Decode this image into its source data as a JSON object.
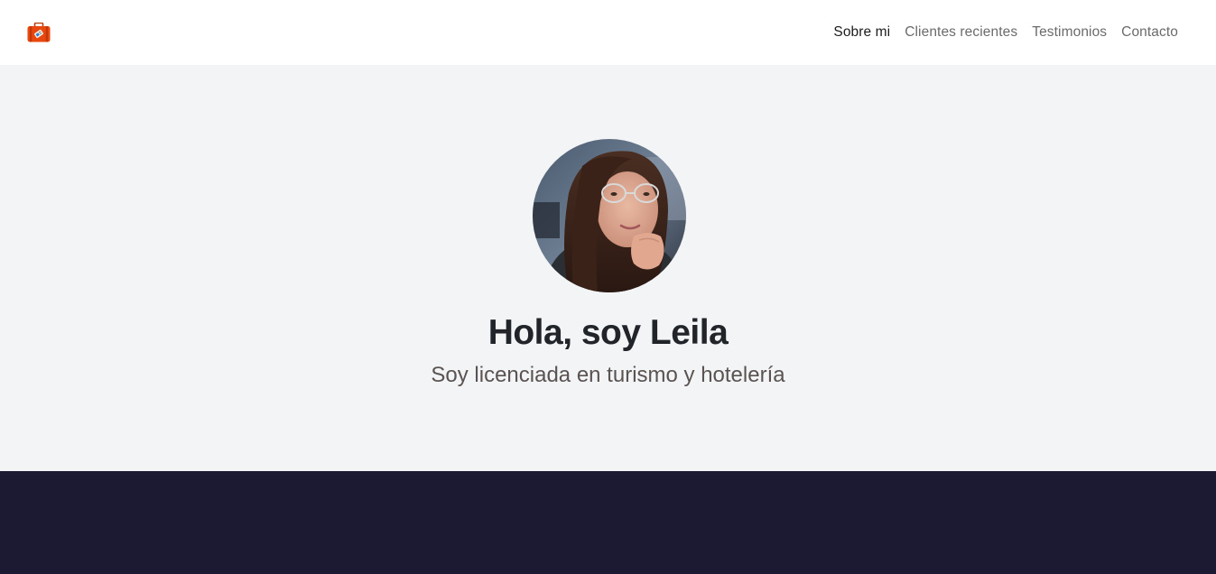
{
  "brand": {
    "icon": "suitcase-icon",
    "color": "#e8470f"
  },
  "nav": {
    "items": [
      {
        "label": "Sobre mi",
        "active": true
      },
      {
        "label": "Clientes recientes",
        "active": false
      },
      {
        "label": "Testimonios",
        "active": false
      },
      {
        "label": "Contacto",
        "active": false
      }
    ]
  },
  "hero": {
    "avatar": "profile-photo",
    "title": "Hola, soy Leila",
    "subtitle": "Soy licenciada en turismo y hotelería"
  },
  "colors": {
    "nav_bg": "#ffffff",
    "hero_bg": "#f3f4f6",
    "dark_section_bg": "#1c1a33",
    "title": "#212529",
    "subtitle": "#5b5352"
  }
}
